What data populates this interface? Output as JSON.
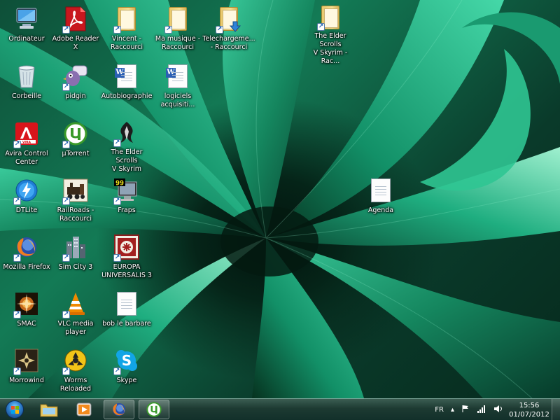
{
  "desktop": {
    "icons": {
      "ordinateur": "Ordinateur",
      "adobe_reader": "Adobe Reader X",
      "vincent": "Vincent -\nRaccourci",
      "ma_musique": "Ma musique -\nRaccourci",
      "telechargements": "Telechargeme...\n- Raccourci",
      "skyrim_folder": "The Elder Scrolls\nV Skyrim - Rac...",
      "corbeille": "Corbeille",
      "pidgin": "pidgin",
      "autobiographie": "Autobiographie",
      "logiciels": "logiciels\nacquisiti...",
      "avira": "Avira Control\nCenter",
      "utorrent": "µTorrent",
      "skyrim_game": "The Elder Scrolls\nV Skyrim",
      "dtlite": "DTLite",
      "railroads": "RailRoads -\nRaccourci",
      "fraps": "Fraps",
      "agenda": "Agenda",
      "firefox": "Mozilla Firefox",
      "simcity": "Sim City 3",
      "europa": "EUROPA\nUNIVERSALIS 3",
      "smac": "SMAC",
      "vlc": "VLC media\nplayer",
      "bob": "bob le barbare",
      "morrowind": "Morrowind",
      "worms": "Worms\nReloaded",
      "skype": "Skype"
    },
    "fraps_counter": "99"
  },
  "taskbar": {
    "language": "FR",
    "time": "15:56",
    "date": "01/07/2012"
  },
  "colors": {
    "wallpaper_dark": "#052418",
    "wallpaper_leaf": "#1fa57a",
    "taskbar": "#1d3a32"
  }
}
